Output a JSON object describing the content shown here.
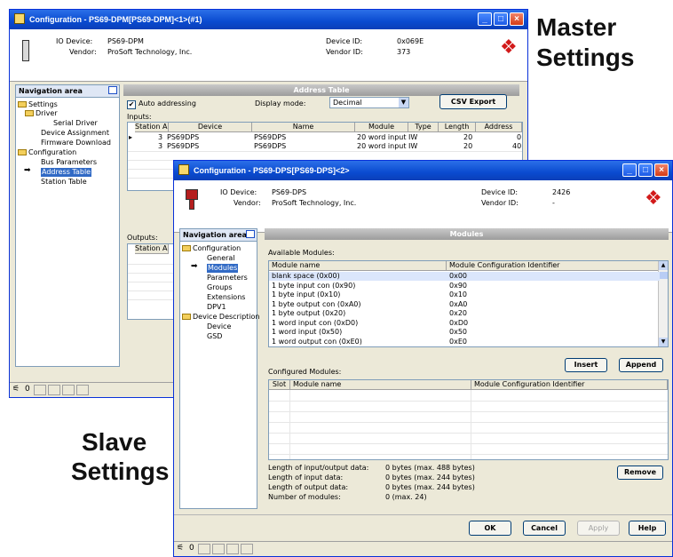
{
  "captions": {
    "master": [
      "Master",
      "Settings"
    ],
    "slave": [
      "Slave",
      "Settings"
    ]
  },
  "master_window": {
    "title": "Configuration - PS69-DPM[PS69-DPM]<1>(#1)",
    "device_label": "IO Device:",
    "device_value": "PS69-DPM",
    "vendor_label": "Vendor:",
    "vendor_value": "ProSoft Technology, Inc.",
    "device_id_label": "Device ID:",
    "device_id_value": "0x069E",
    "vendor_id_label": "Vendor ID:",
    "vendor_id_value": "373",
    "nav_title": "Navigation area",
    "nav_items": [
      "Settings",
      "Driver",
      "Serial Driver",
      "Device Assignment",
      "Firmware Download",
      "Configuration",
      "Bus Parameters",
      "Address Table",
      "Station Table"
    ],
    "section_title": "Address Table",
    "auto_addressing_label": "Auto addressing",
    "display_mode_label": "Display mode:",
    "display_mode_value": "Decimal",
    "csv_export": "CSV Export",
    "inputs_label": "Inputs:",
    "outputs_label": "Outputs:",
    "columns": [
      "Station A...",
      "Device",
      "Name",
      "Module",
      "Type",
      "Length",
      "Address"
    ],
    "input_rows": [
      {
        "station": "3",
        "device": "PS69DPS",
        "name": "PS69DPS",
        "module": "20 word input",
        "type": "IW",
        "length": "20",
        "address": "0"
      },
      {
        "station": "3",
        "device": "PS69DPS",
        "name": "PS69DPS",
        "module": "20 word input",
        "type": "IW",
        "length": "20",
        "address": "40"
      }
    ],
    "output_col": "Station A..."
  },
  "slave_window": {
    "title": "Configuration - PS69-DPS[PS69-DPS]<2>",
    "device_label": "IO Device:",
    "device_value": "PS69-DPS",
    "vendor_label": "Vendor:",
    "vendor_value": "ProSoft Technology, Inc.",
    "device_id_label": "Device ID:",
    "device_id_value": "2426",
    "vendor_id_label": "Vendor ID:",
    "vendor_id_value": "-",
    "nav_title": "Navigation area",
    "nav_items": [
      "Configuration",
      "General",
      "Modules",
      "Parameters",
      "Groups",
      "Extensions",
      "DPV1",
      "Device Description",
      "Device",
      "GSD"
    ],
    "section_title": "Modules",
    "available_label": "Available Modules:",
    "available_columns": [
      "Module name",
      "Module Configuration Identifier"
    ],
    "available_rows": [
      {
        "name": "blank space (0x00)",
        "id": "0x00"
      },
      {
        "name": "1 byte input con (0x90)",
        "id": "0x90"
      },
      {
        "name": "1 byte input (0x10)",
        "id": "0x10"
      },
      {
        "name": "1 byte output con (0xA0)",
        "id": "0xA0"
      },
      {
        "name": "1 byte output (0x20)",
        "id": "0x20"
      },
      {
        "name": "1 word input con (0xD0)",
        "id": "0xD0"
      },
      {
        "name": "1 word input (0x50)",
        "id": "0x50"
      },
      {
        "name": "1 word output con (0xE0)",
        "id": "0xE0"
      }
    ],
    "insert": "Insert",
    "append": "Append",
    "configured_label": "Configured Modules:",
    "configured_columns": [
      "Slot",
      "Module name",
      "Module Configuration Identifier"
    ],
    "summary": [
      {
        "label": "Length of input/output data:",
        "value": "0 bytes (max. 488 bytes)"
      },
      {
        "label": "Length of input data:",
        "value": "0 bytes (max. 244 bytes)"
      },
      {
        "label": "Length of output data:",
        "value": "0 bytes (max. 244 bytes)"
      },
      {
        "label": "Number of modules:",
        "value": "0 (max. 24)"
      }
    ],
    "remove": "Remove",
    "buttons": {
      "ok": "OK",
      "cancel": "Cancel",
      "apply": "Apply",
      "help": "Help"
    }
  },
  "status_glyph": "0",
  "colors": {
    "title_bar": "#0a4bd0",
    "accent_red": "#d21a1a",
    "selection": "#316ac5"
  }
}
